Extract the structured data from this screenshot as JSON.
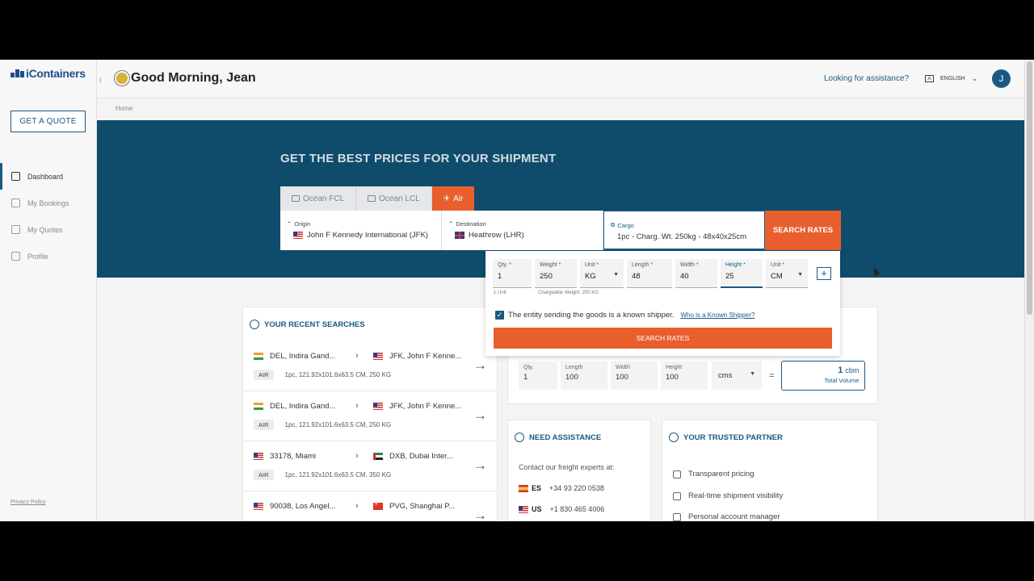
{
  "brand": {
    "logo": "iContainers"
  },
  "sidebar": {
    "quote_button": "GET A QUOTE",
    "items": [
      {
        "label": "Dashboard"
      },
      {
        "label": "My Bookings"
      },
      {
        "label": "My Quotes"
      },
      {
        "label": "Profile"
      }
    ],
    "privacy": "Privacy Policy"
  },
  "header": {
    "greeting": "Good Morning, Jean",
    "assist_link": "Looking for assistance?",
    "language": "ENGLISH",
    "avatar": "J"
  },
  "breadcrumb": {
    "home": "Home"
  },
  "hero": {
    "title": "GET THE BEST PRICES FOR YOUR SHIPMENT",
    "tabs": [
      {
        "label": "Ocean FCL"
      },
      {
        "label": "Ocean LCL"
      },
      {
        "label": "Air"
      }
    ],
    "origin_label": "Origin",
    "origin_value": "John F Kennedy International (JFK)",
    "destination_label": "Destination",
    "destination_value": "Heathrow (LHR)",
    "cargo_label": "Cargo",
    "cargo_value": "1pc - Charg. Wt. 250kg - 48x40x25cm",
    "search_button": "SEARCH RATES"
  },
  "cargo_panel": {
    "qty_label": "Qty. *",
    "qty_value": "1",
    "weight_label": "Weight *",
    "weight_value": "250",
    "weight_unit_label": "Unit *",
    "weight_unit_value": "KG",
    "length_label": "Length *",
    "length_value": "48",
    "width_label": "Width *",
    "width_value": "40",
    "height_label": "Height *",
    "height_value": "25",
    "dim_unit_label": "Unit *",
    "dim_unit_value": "CM",
    "units_note": "1 Unit",
    "chargeable_note": "Chargeable Weight: 250 KG",
    "known_shipper_text": "The entity sending the goods is a known shipper.",
    "known_shipper_link": "Who is a Known Shipper?",
    "search_button": "SEARCH RATES"
  },
  "recent": {
    "title": "YOUR RECENT SEARCHES",
    "items": [
      {
        "from": "DEL, Indira Gand...",
        "to": "JFK, John F Kenne...",
        "mode": "AIR",
        "details": "1pc, 121.92x101.6x63.5 CM, 250 KG"
      },
      {
        "from": "DEL, Indira Gand...",
        "to": "JFK, John F Kenne...",
        "mode": "AIR",
        "details": "1pc, 121.92x101.6x63.5 CM, 250 KG"
      },
      {
        "from": "33178, Miami",
        "to": "DXB, Dubai Inter...",
        "mode": "AIR",
        "details": "1pc, 121.92x101.6x63.5 CM, 350 KG"
      },
      {
        "from": "90038, Los Angel...",
        "to": "PVG, Shanghai P...",
        "mode": "",
        "details": ""
      }
    ]
  },
  "calculator": {
    "qty_label": "Qty.",
    "qty_value": "1",
    "length_label": "Length",
    "length_value": "100",
    "width_label": "Width",
    "width_value": "100",
    "height_label": "Height",
    "height_value": "100",
    "unit_value": "cms",
    "equals": "=",
    "total_value": "1",
    "total_unit": "cbm",
    "total_label": "Total Volume"
  },
  "assistance": {
    "title": "NEED ASSISTANCE",
    "intro": "Contact our freight experts at:",
    "phones": [
      {
        "country": "ES",
        "number": "+34 93 220 0538"
      },
      {
        "country": "US",
        "number": "+1 830 465 4006"
      }
    ]
  },
  "partner": {
    "title": "YOUR TRUSTED PARTNER",
    "benefits": [
      {
        "label": "Transparent pricing"
      },
      {
        "label": "Real-time shipment visibility"
      },
      {
        "label": "Personal account manager"
      }
    ]
  }
}
